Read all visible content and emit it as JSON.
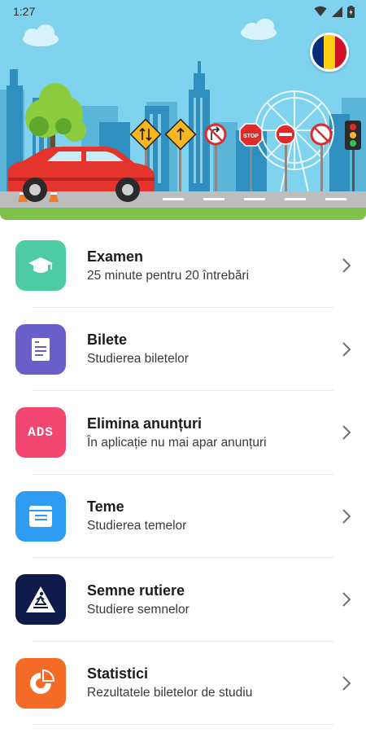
{
  "status_bar": {
    "time": "1:27",
    "icons": [
      "wifi-icon",
      "cell-signal-icon",
      "battery-icon"
    ]
  },
  "header": {
    "illustration": "city-street-car-road-signs",
    "language_flag": {
      "country": "Romania",
      "colors": [
        "#002B7F",
        "#FCD116",
        "#CE1126"
      ]
    }
  },
  "menu": {
    "items": [
      {
        "id": "examen",
        "title": "Examen",
        "subtitle": "25 minute pentru 20 întrebări",
        "icon": "graduation-cap-icon",
        "color": "#4ecba5"
      },
      {
        "id": "bilete",
        "title": "Bilete",
        "subtitle": "Studierea biletelor",
        "icon": "document-icon",
        "color": "#6a5fc9"
      },
      {
        "id": "ads",
        "title": "Elimina anunțuri",
        "subtitle": "În aplicație nu mai apar anunțuri",
        "icon": "ads-icon",
        "icon_text": "ADS",
        "color": "#f2466f"
      },
      {
        "id": "teme",
        "title": "Teme",
        "subtitle": "Studierea temelor",
        "icon": "folder-icon",
        "color": "#2e9cf2"
      },
      {
        "id": "semne",
        "title": "Semne rutiere",
        "subtitle": "Studiere semnelor",
        "icon": "pedestrian-crossing-icon",
        "color": "#0e1a4a"
      },
      {
        "id": "statistici",
        "title": "Statistici",
        "subtitle": "Rezultatele biletelor de studiu",
        "icon": "chart-icon",
        "color": "#f36b27"
      }
    ]
  }
}
